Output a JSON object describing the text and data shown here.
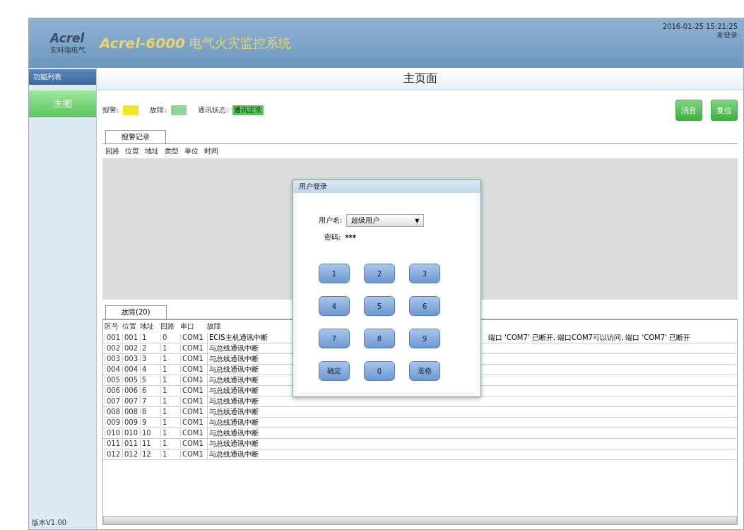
{
  "header": {
    "logo": "Acrel",
    "logo_sub": "安科瑞电气",
    "title": "Acrel-6000",
    "subtitle": "电气火灾监控系统",
    "datetime": "2016-01-25 15:21:25",
    "user": "未登录"
  },
  "sidebar": {
    "heading": "功能列表",
    "items": [
      {
        "label": "主图",
        "selected": true
      }
    ],
    "version": "版本V1.00"
  },
  "page_title": "主页面",
  "legend": [
    {
      "label": "报警:",
      "color": "#f2e62a"
    },
    {
      "label": "故障:",
      "color": "#8fd49a"
    },
    {
      "label": "通讯状态:",
      "color": "#5cc45c",
      "text": "通讯正常"
    }
  ],
  "actions": [
    "消音",
    "复位"
  ],
  "alarm_panel": {
    "tab": "报警记录",
    "columns": [
      "回路",
      "位置",
      "地址",
      "类型",
      "单位",
      "时间"
    ]
  },
  "fault_panel": {
    "tab": "故障(20)",
    "columns": [
      "区号",
      "位置",
      "地址",
      "回路",
      "串口",
      "故障"
    ],
    "rows": [
      [
        "001",
        "001",
        "1",
        "0",
        "COM1",
        "ECIS主机通讯中断",
        "端口 'COM7' 已断开, 端口COM7可以访问, 端口 'COM7' 已断开"
      ],
      [
        "002",
        "002",
        "2",
        "1",
        "COM1",
        "与总线通讯中断",
        ""
      ],
      [
        "003",
        "003",
        "3",
        "1",
        "COM1",
        "与总线通讯中断",
        ""
      ],
      [
        "004",
        "004",
        "4",
        "1",
        "COM1",
        "与总线通讯中断",
        ""
      ],
      [
        "005",
        "005",
        "5",
        "1",
        "COM1",
        "与总线通讯中断",
        ""
      ],
      [
        "006",
        "006",
        "6",
        "1",
        "COM1",
        "与总线通讯中断",
        ""
      ],
      [
        "007",
        "007",
        "7",
        "1",
        "COM1",
        "与总线通讯中断",
        ""
      ],
      [
        "008",
        "008",
        "8",
        "1",
        "COM1",
        "与总线通讯中断",
        ""
      ],
      [
        "009",
        "009",
        "9",
        "1",
        "COM1",
        "与总线通讯中断",
        ""
      ],
      [
        "010",
        "010",
        "10",
        "1",
        "COM1",
        "与总线通讯中断",
        ""
      ],
      [
        "011",
        "011",
        "11",
        "1",
        "COM1",
        "与总线通讯中断",
        ""
      ],
      [
        "012",
        "012",
        "12",
        "1",
        "COM1",
        "与总线通讯中断",
        ""
      ]
    ]
  },
  "login_dialog": {
    "title": "用户登录",
    "user_label": "用户名:",
    "user_value": "超级用户",
    "dropdown_arrow": "▼",
    "password_label": "密码:",
    "password_value": "***",
    "keys": [
      "1",
      "2",
      "3",
      "4",
      "5",
      "6",
      "7",
      "8",
      "9",
      "确定",
      "0",
      "退格"
    ]
  }
}
